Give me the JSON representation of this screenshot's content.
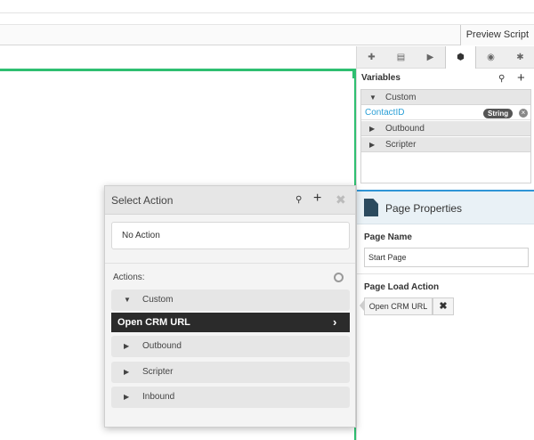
{
  "toolbar": {
    "preview_label": "Preview Script"
  },
  "right_panel": {
    "tabs": [
      {
        "icon": "puzzle-icon",
        "glyph": "✚"
      },
      {
        "icon": "document-icon",
        "glyph": "▤"
      },
      {
        "icon": "play-icon",
        "glyph": "▶"
      },
      {
        "icon": "cube-icon",
        "glyph": "⬢"
      },
      {
        "icon": "eye-icon",
        "glyph": "◉"
      },
      {
        "icon": "bug-icon",
        "glyph": "✱"
      }
    ],
    "active_tab": 3,
    "variables": {
      "title": "Variables",
      "search_glyph": "⚲",
      "add_glyph": "+",
      "custom": {
        "label": "Custom",
        "expanded_glyph": "▼"
      },
      "contact": {
        "name": "ContactID",
        "type": "String",
        "remove_glyph": "×"
      },
      "outbound": {
        "label": "Outbound",
        "collapsed_glyph": "▶"
      },
      "scripter": {
        "label": "Scripter",
        "collapsed_glyph": "▶"
      }
    },
    "page_properties": {
      "title": "Page Properties",
      "page_name_label": "Page Name",
      "page_name_value": "Start Page",
      "page_load_label": "Page Load Action",
      "page_load_value": "Open CRM URL",
      "clear_glyph": "✖"
    }
  },
  "dialog": {
    "title": "Select Action",
    "search_glyph": "⚲",
    "add_glyph": "+",
    "close_glyph": "✖",
    "no_action": "No Action",
    "actions_label": "Actions:",
    "custom": {
      "label": "Custom",
      "glyph": "▼"
    },
    "selected": {
      "label": "Open CRM URL",
      "glyph": "›"
    },
    "outbound": {
      "label": "Outbound",
      "glyph": "▶"
    },
    "scripter": {
      "label": "Scripter",
      "glyph": "▶"
    },
    "inbound": {
      "label": "Inbound",
      "glyph": "▶"
    }
  },
  "colors": {
    "accent_green": "#2fbf71",
    "accent_blue": "#2f95d6",
    "selected_row": "#2b2b2b"
  }
}
